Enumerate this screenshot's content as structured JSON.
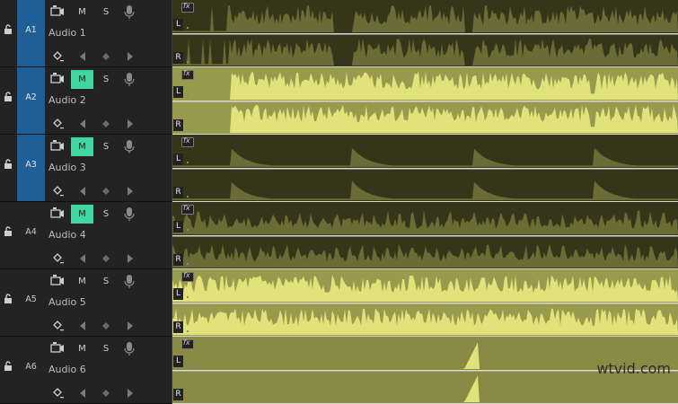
{
  "tracks": [
    {
      "id": "A1",
      "name": "Audio 1",
      "targeted": true,
      "mute_on": false,
      "wave_style": "dim",
      "mute_label": "M",
      "solo_label": "S"
    },
    {
      "id": "A2",
      "name": "Audio 2",
      "targeted": true,
      "mute_on": true,
      "wave_style": "bright",
      "mute_label": "M",
      "solo_label": "S"
    },
    {
      "id": "A3",
      "name": "Audio 3",
      "targeted": true,
      "mute_on": true,
      "wave_style": "sparse",
      "mute_label": "M",
      "solo_label": "S"
    },
    {
      "id": "A4",
      "name": "Audio 4",
      "targeted": false,
      "mute_on": true,
      "wave_style": "dim-dense",
      "mute_label": "M",
      "solo_label": "S"
    },
    {
      "id": "A5",
      "name": "Audio 5",
      "targeted": false,
      "mute_on": false,
      "wave_style": "bright-dense",
      "mute_label": "M",
      "solo_label": "S"
    },
    {
      "id": "A6",
      "name": "Audio 6",
      "targeted": false,
      "mute_on": false,
      "wave_style": "spike",
      "mute_label": "M",
      "solo_label": "S"
    }
  ],
  "channel_labels": {
    "left": "L",
    "right": "R"
  },
  "fx_label": "fx",
  "watermark": "wtvid.com",
  "colors": {
    "target_on": "#1f5f98",
    "mute_on": "#3fd6a0",
    "clip_dim": "#35351a",
    "wave_dim": "#6b6b35",
    "clip_bright": "#9a9a4f",
    "wave_bright": "#e2e27a",
    "clip_mid": "#8a8a45"
  }
}
